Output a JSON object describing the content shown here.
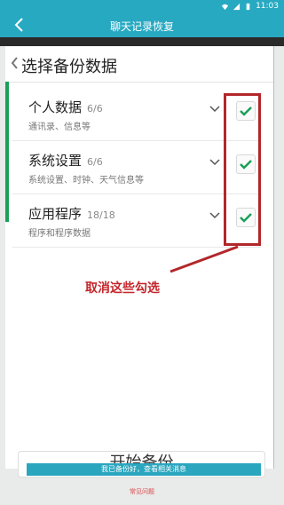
{
  "status_bar": {
    "time": "11:03"
  },
  "app_bar": {
    "title": "聊天记录恢复"
  },
  "panel": {
    "title": "选择备份数据",
    "items": [
      {
        "name": "个人数据",
        "count": "6/6",
        "desc": "通讯录、信息等",
        "checked": true
      },
      {
        "name": "系统设置",
        "count": "6/6",
        "desc": "系统设置、时钟、天气信息等",
        "checked": true
      },
      {
        "name": "应用程序",
        "count": "18/18",
        "desc": "程序和程序数据",
        "checked": true
      }
    ]
  },
  "annotation": {
    "text": "取消这些勾选",
    "color": "#c3262b"
  },
  "bottom": {
    "start_button_label": "开始备份",
    "bar_text": "我已备份好，查看相关消息",
    "faq_link": "常见问题"
  },
  "colors": {
    "accent": "#28a9c2",
    "check": "#1aa05a"
  }
}
